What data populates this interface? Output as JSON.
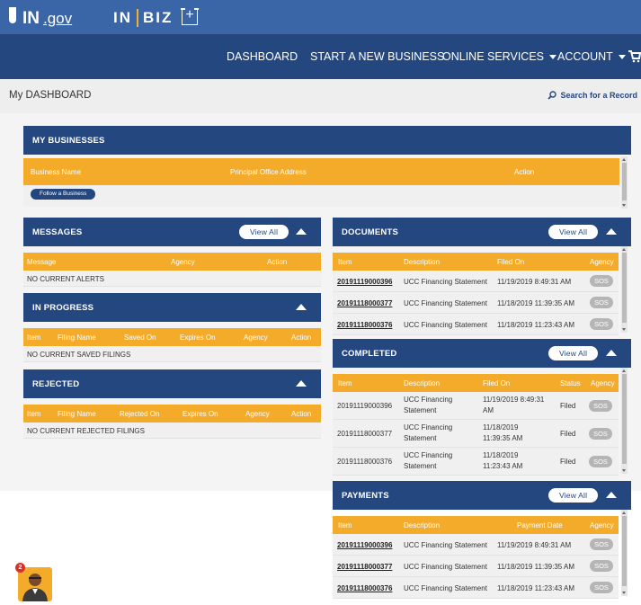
{
  "header": {
    "ingov_logo": "IN",
    "ingov_suffix": ".gov",
    "inbiz_left": "IN",
    "inbiz_right": "BIZ"
  },
  "nav": {
    "dashboard": "DASHBOARD",
    "start_business": "START A NEW BUSINESS",
    "online_services": "ONLINE SERVICES",
    "account": "ACCOUNT"
  },
  "dashboard": {
    "title": "My DASHBOARD",
    "search_label": "Search for a Record"
  },
  "my_businesses": {
    "title": "MY BUSINESSES",
    "columns": [
      "Business Name",
      "Principal Office Address",
      "Action"
    ],
    "follow_button": "Follow a Business"
  },
  "messages": {
    "title": "MESSAGES",
    "view_all": "View All",
    "columns": [
      "Message",
      "Agency",
      "Action"
    ],
    "empty": "NO CURRENT ALERTS"
  },
  "in_progress": {
    "title": "IN PROGRESS",
    "columns": [
      "Item",
      "Filing Name",
      "Saved On",
      "Expires On",
      "Agency",
      "Action"
    ],
    "empty": "NO CURRENT SAVED FILINGS"
  },
  "rejected": {
    "title": "REJECTED",
    "columns": [
      "Item",
      "Filing Name",
      "Rejected On",
      "Expires On",
      "Agency",
      "Action"
    ],
    "empty": "NO CURRENT REJECTED FILINGS"
  },
  "documents": {
    "title": "DOCUMENTS",
    "view_all": "View All",
    "columns": [
      "Item",
      "Description",
      "Filed On",
      "Agency"
    ],
    "rows": [
      {
        "item": "20191119000396",
        "description": "UCC Financing Statement",
        "filed_on": "11/19/2019 8:49:31 AM",
        "agency": "SOS"
      },
      {
        "item": "20191118000377",
        "description": "UCC Financing Statement",
        "filed_on": "11/18/2019 11:39:35 AM",
        "agency": "SOS"
      },
      {
        "item": "20191118000376",
        "description": "UCC Financing Statement",
        "filed_on": "11/18/2019 11:23:43 AM",
        "agency": "SOS"
      }
    ]
  },
  "completed": {
    "title": "COMPLETED",
    "view_all": "View All",
    "columns": [
      "Item",
      "Description",
      "Filed On",
      "Status",
      "Agency"
    ],
    "rows": [
      {
        "item": "20191119000396",
        "desc1": "UCC Financing",
        "desc2": "Statement",
        "filed1": "11/19/2019 8:49:31",
        "filed2": "AM",
        "status": "Filed",
        "agency": "SOS"
      },
      {
        "item": "20191118000377",
        "desc1": "UCC Financing",
        "desc2": "Statement",
        "filed1": "11/18/2019",
        "filed2": "11:39:35 AM",
        "status": "Filed",
        "agency": "SOS"
      },
      {
        "item": "20191118000376",
        "desc1": "UCC Financing",
        "desc2": "Statement",
        "filed1": "11/18/2019",
        "filed2": "11:23:43 AM",
        "status": "Filed",
        "agency": "SOS"
      }
    ]
  },
  "payments": {
    "title": "PAYMENTS",
    "view_all": "View All",
    "columns": [
      "Item",
      "Description",
      "Payment Date",
      "Agency"
    ],
    "rows": [
      {
        "item": "20191119000396",
        "description": "UCC Financing Statement",
        "date": "11/19/2019 8:49:31 AM",
        "agency": "SOS"
      },
      {
        "item": "20191118000377",
        "description": "UCC Financing Statement",
        "date": "11/18/2019 11:39:35 AM",
        "agency": "SOS"
      },
      {
        "item": "20191118000376",
        "description": "UCC Financing Statement",
        "date": "11/18/2019 11:23:43 AM",
        "agency": "SOS"
      }
    ]
  },
  "chat": {
    "badge_count": "2"
  },
  "colors": {
    "navy": "#24477f",
    "top_blue": "#3a66a8",
    "orange": "#f5ab2a"
  }
}
